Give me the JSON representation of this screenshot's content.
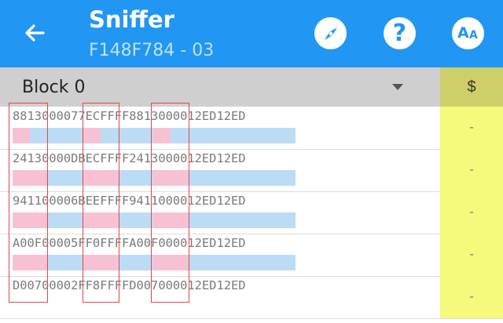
{
  "app": {
    "title": "Sniffer",
    "subtitle": "F148F784 - 03"
  },
  "block": {
    "selected": "Block 0"
  },
  "column": {
    "dollar": "$"
  },
  "rows": [
    {
      "hex": "8813000077ECFFFF8813000012ED12ED",
      "value": "-"
    },
    {
      "hex": "24130000DBECFFFF2413000012ED12ED",
      "value": "-"
    },
    {
      "hex": "941100006BEEFFFF9411000012ED12ED",
      "value": "-"
    },
    {
      "hex": "A00F00005FF0FFFFA00F000012ED12ED",
      "value": "-"
    },
    {
      "hex": "D00700002FF8FFFFD007000012ED12ED",
      "value": "-"
    }
  ],
  "icons": {
    "back": "arrow-left-icon",
    "compass": "compass-icon",
    "help": "help-icon",
    "font": "font-size-icon",
    "dropdown": "dropdown-triangle-icon"
  },
  "colors": {
    "appbar": "#2196f3",
    "highlight_byte": "#f7c1d3",
    "data_bar": "#bcdcf5",
    "dollar_column": "#f5f97c",
    "selection_box": "#e0493f"
  }
}
